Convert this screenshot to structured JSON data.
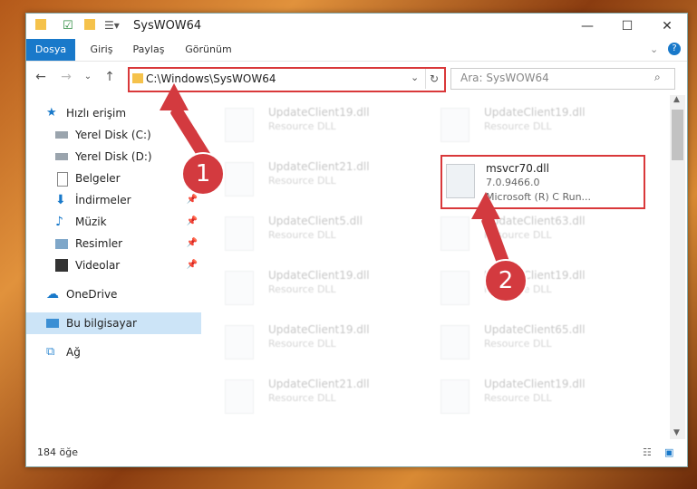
{
  "window": {
    "title": "SysWOW64",
    "minimize": "—",
    "maximize": "☐",
    "close": "✕"
  },
  "ribbon": {
    "tabs": [
      "Dosya",
      "Giriş",
      "Paylaş",
      "Görünüm"
    ],
    "help": "?"
  },
  "address": {
    "path": "C:\\Windows\\SysWOW64",
    "search_placeholder": "Ara: SysWOW64"
  },
  "nav": {
    "items": [
      {
        "label": "Hızlı erişim"
      },
      {
        "label": "Yerel Disk (C:)"
      },
      {
        "label": "Yerel Disk (D:)"
      },
      {
        "label": "Belgeler"
      },
      {
        "label": "İndirmeler"
      },
      {
        "label": "Müzik"
      },
      {
        "label": "Resimler"
      },
      {
        "label": "Videolar"
      },
      {
        "label": "OneDrive"
      },
      {
        "label": "Bu bilgisayar"
      },
      {
        "label": "Ağ"
      }
    ]
  },
  "files": [
    {
      "name": "UpdateClient19.dll",
      "desc": "Resource DLL"
    },
    {
      "name": "UpdateClient19.dll",
      "desc": "Resource DLL"
    },
    {
      "name": "UpdateClient21.dll",
      "desc": "Resource DLL"
    },
    {
      "name": "msvcr70.dll",
      "desc": "7.0.9466.0",
      "desc2": "Microsoft (R) C Run..."
    },
    {
      "name": "UpdateClient5.dll",
      "desc": "Resource DLL"
    },
    {
      "name": "UpdateClient63.dll",
      "desc": "Resource DLL"
    },
    {
      "name": "UpdateClient19.dll",
      "desc": "Resource DLL"
    },
    {
      "name": "UpdateClient19.dll",
      "desc": "Resource DLL"
    },
    {
      "name": "UpdateClient19.dll",
      "desc": "Resource DLL"
    },
    {
      "name": "UpdateClient65.dll",
      "desc": "Resource DLL"
    },
    {
      "name": "UpdateClient21.dll",
      "desc": "Resource DLL"
    },
    {
      "name": "UpdateClient19.dll",
      "desc": "Resource DLL"
    }
  ],
  "status": {
    "count": "184 öğe"
  },
  "annotations": {
    "badge1": "1",
    "badge2": "2"
  },
  "colors": {
    "accent": "#1979ca",
    "highlight": "#d9383a"
  }
}
